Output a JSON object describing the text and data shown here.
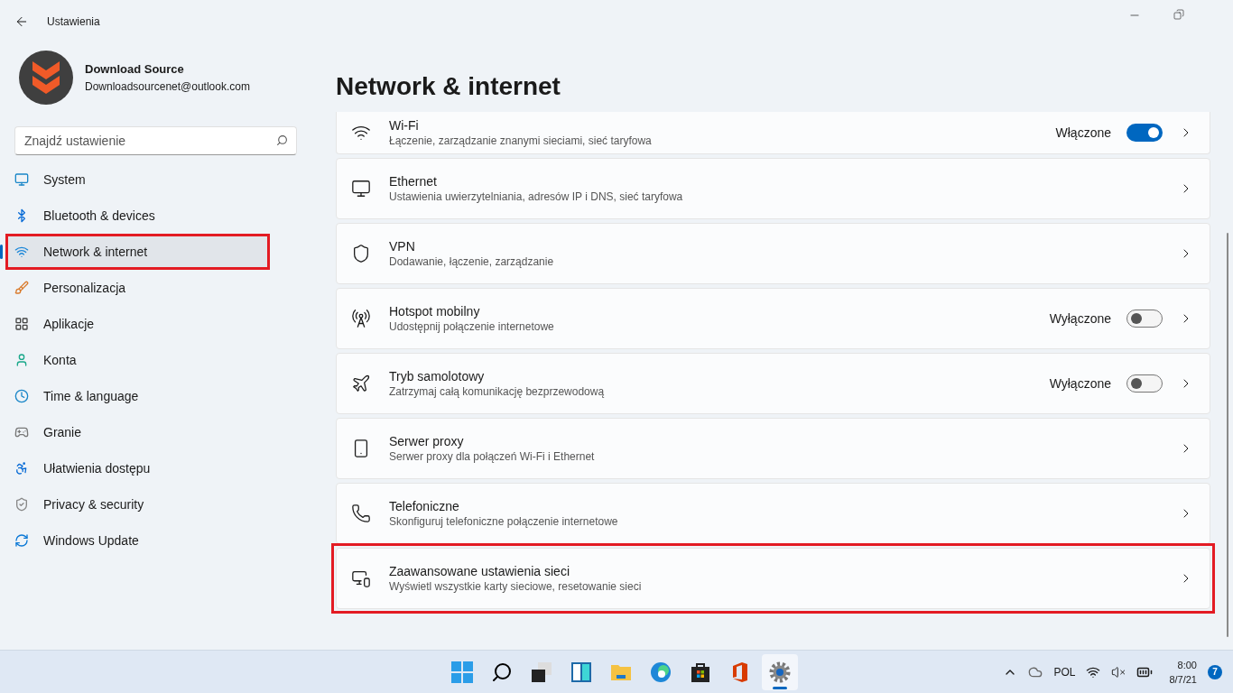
{
  "window": {
    "title": "Ustawienia"
  },
  "account": {
    "name": "Download Source",
    "email": "Downloadsourcenet@outlook.com"
  },
  "search": {
    "placeholder": "Znajdź ustawienie"
  },
  "sidebar": {
    "items": [
      {
        "label": "System",
        "kind": "system",
        "selected": false,
        "highlighted": false
      },
      {
        "label": "Bluetooth & devices",
        "kind": "bluetooth",
        "selected": false,
        "highlighted": false
      },
      {
        "label": "Network & internet",
        "kind": "network",
        "selected": true,
        "highlighted": true
      },
      {
        "label": "Personalizacja",
        "kind": "brush",
        "selected": false,
        "highlighted": false
      },
      {
        "label": "Aplikacje",
        "kind": "apps",
        "selected": false,
        "highlighted": false
      },
      {
        "label": "Konta",
        "kind": "account",
        "selected": false,
        "highlighted": false
      },
      {
        "label": "Time & language",
        "kind": "time",
        "selected": false,
        "highlighted": false
      },
      {
        "label": "Granie",
        "kind": "gaming",
        "selected": false,
        "highlighted": false
      },
      {
        "label": "Ułatwienia dostępu",
        "kind": "accessibility",
        "selected": false,
        "highlighted": false
      },
      {
        "label": "Privacy & security",
        "kind": "privacy",
        "selected": false,
        "highlighted": false
      },
      {
        "label": "Windows Update",
        "kind": "update",
        "selected": false,
        "highlighted": false
      }
    ]
  },
  "page": {
    "title": "Network & internet"
  },
  "cards": [
    {
      "kind": "wifi",
      "title": "Wi-Fi",
      "subtitle": "Łączenie, zarządzanie znanymi sieciami, sieć taryfowa",
      "status": "Włączone",
      "on": true,
      "highlighted": false
    },
    {
      "kind": "ethernet",
      "title": "Ethernet",
      "subtitle": "Ustawienia uwierzytelniania, adresów IP i DNS, sieć taryfowa",
      "highlighted": false
    },
    {
      "kind": "vpn",
      "title": "VPN",
      "subtitle": "Dodawanie, łączenie, zarządzanie",
      "highlighted": false
    },
    {
      "kind": "hotspot",
      "title": "Hotspot mobilny",
      "subtitle": "Udostępnij połączenie internetowe",
      "status": "Wyłączone",
      "on": false,
      "highlighted": false
    },
    {
      "kind": "airplane",
      "title": "Tryb samolotowy",
      "subtitle": "Zatrzymaj całą komunikację bezprzewodową",
      "status": "Wyłączone",
      "on": false,
      "highlighted": false
    },
    {
      "kind": "proxy",
      "title": "Serwer proxy",
      "subtitle": "Serwer proxy dla połączeń Wi-Fi i Ethernet",
      "highlighted": false
    },
    {
      "kind": "dialup",
      "title": "Telefoniczne",
      "subtitle": "Skonfiguruj telefoniczne połączenie internetowe",
      "highlighted": false
    },
    {
      "kind": "advanced",
      "title": "Zaawansowane ustawienia sieci",
      "subtitle": "Wyświetl wszystkie karty sieciowe, resetowanie sieci",
      "highlighted": true
    }
  ],
  "taskbar": {
    "items": [
      {
        "kind": "start",
        "selected": false
      },
      {
        "kind": "search",
        "selected": false
      },
      {
        "kind": "taskview",
        "selected": false
      },
      {
        "kind": "widgets",
        "selected": false
      },
      {
        "kind": "explorer",
        "selected": false
      },
      {
        "kind": "edge",
        "selected": false
      },
      {
        "kind": "store",
        "selected": false
      },
      {
        "kind": "office",
        "selected": false
      },
      {
        "kind": "settings",
        "selected": true
      }
    ]
  },
  "tray": {
    "language": "POL",
    "time": "8:00",
    "date": "8/7/21",
    "notifications": "7"
  }
}
